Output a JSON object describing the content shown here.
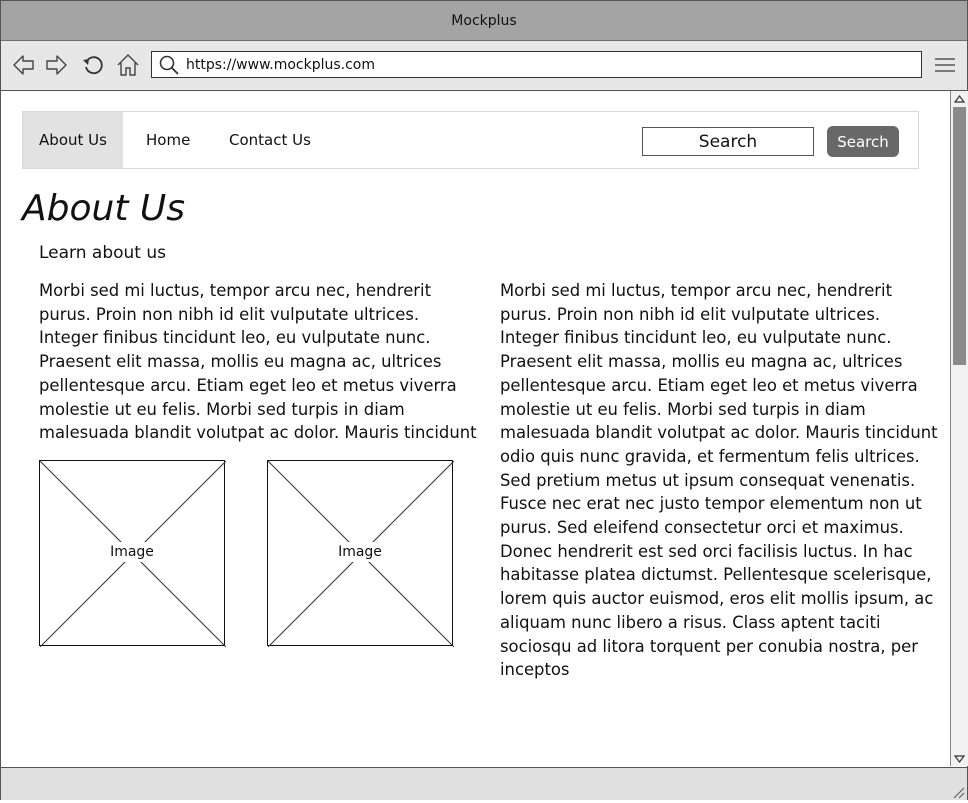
{
  "window": {
    "title": "Mockplus"
  },
  "browser": {
    "url": "https://www.mockplus.com",
    "icons": [
      "back-icon",
      "forward-icon",
      "refresh-icon",
      "home-icon",
      "search-icon",
      "hamburger-menu-icon"
    ]
  },
  "site": {
    "nav": {
      "items": [
        {
          "label": "About Us",
          "active": true
        },
        {
          "label": "Home",
          "active": false
        },
        {
          "label": "Contact Us",
          "active": false
        }
      ],
      "search_input": "Search",
      "search_button": "Search"
    },
    "title": "About Us",
    "subtitle": "Learn about us",
    "left_paragraph": "Morbi sed mi luctus, tempor arcu nec, hendrerit purus. Proin non nibh id elit vulputate ultrices. Integer finibus tincidunt leo, eu vulputate nunc. Praesent elit massa, mollis eu magna ac, ultrices pellentesque arcu. Etiam eget leo et metus viverra molestie ut eu felis. Morbi sed turpis in diam malesuada blandit volutpat ac dolor. Mauris tincidunt odio quis nunc gravida, et fermentum",
    "right_paragraph": "Morbi sed mi luctus, tempor arcu nec, hendrerit purus. Proin non nibh id elit vulputate ultrices. Integer finibus tincidunt leo, eu vulputate nunc. Praesent elit massa, mollis eu magna ac, ultrices pellentesque arcu. Etiam eget leo et metus viverra molestie ut eu felis. Morbi sed turpis in diam malesuada blandit volutpat ac dolor. Mauris tincidunt odio quis nunc gravida, et fermentum felis ultrices. Sed pretium metus ut ipsum consequat venenatis. Fusce nec erat nec justo tempor elementum non ut purus. Sed eleifend consectetur orci et maximus. Donec hendrerit est sed orci facilisis luctus. In hac habitasse platea dictumst. Pellentesque scelerisque, lorem quis auctor euismod, eros elit mollis ipsum, ac aliquam nunc libero a risus. Class aptent taciti sociosqu ad litora torquent per conubia nostra, per inceptos",
    "images": [
      {
        "label": "Image"
      },
      {
        "label": "Image"
      }
    ]
  },
  "colors": {
    "titlebar": "#a3a3a3",
    "toolbar": "#e7e7e7",
    "active_nav": "#e2e2e2",
    "search_button": "#686868",
    "scroll_thumb": "#8a8a8a"
  }
}
